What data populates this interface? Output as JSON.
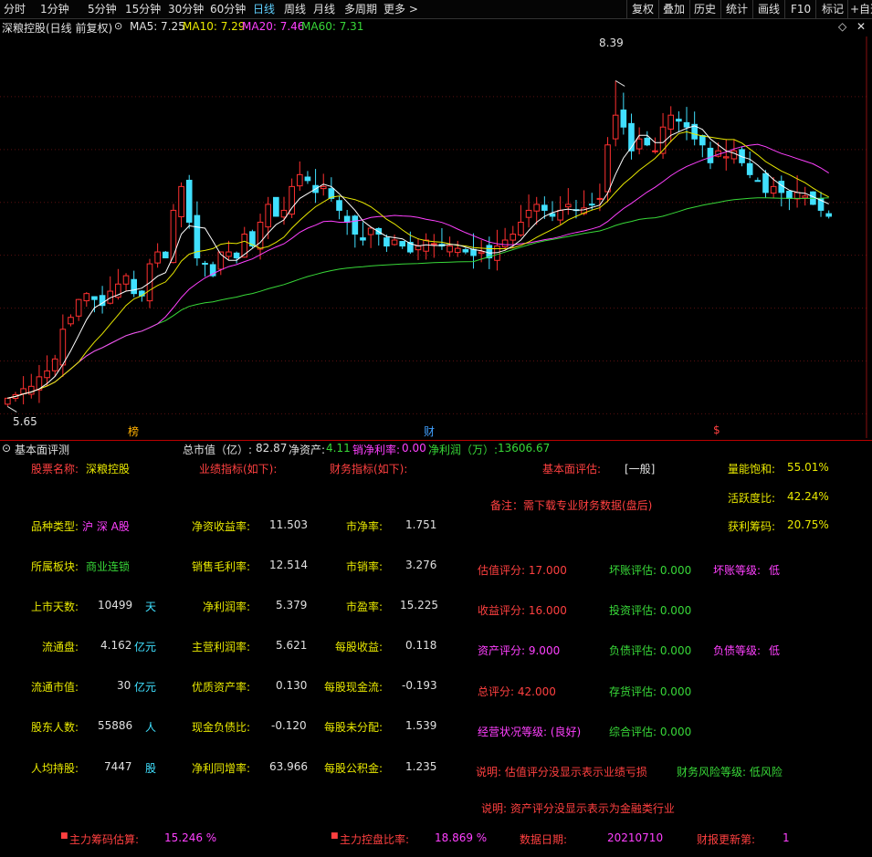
{
  "toolbar": {
    "periods": [
      "分时",
      "1分钟",
      "5分钟",
      "15分钟",
      "30分钟",
      "60分钟",
      "日线",
      "周线",
      "月线",
      "多周期",
      "更多 >"
    ],
    "active_period": "日线",
    "right_buttons": [
      "复权",
      "叠加",
      "历史",
      "统计",
      "画线",
      "F10",
      "标记",
      "+自选"
    ]
  },
  "indicator_bar": {
    "stock_title": "深粮控股(日线 前复权)",
    "ma5": "MA5: 7.25",
    "ma10": "MA10: 7.29",
    "ma20": "MA20: 7.46",
    "ma60": "MA60: 7.31"
  },
  "chart_data": {
    "type": "candlestick",
    "high_label": "8.39",
    "low_label": "5.65",
    "ylim": [
      5.5,
      8.7
    ],
    "markers": [
      "榜",
      "财",
      "$"
    ],
    "colors": {
      "up": "#ff3030",
      "down": "#40e0ff",
      "ma5": "#ffffff",
      "ma10": "#e8e800",
      "ma20": "#ff40ff",
      "ma60": "#38d838"
    },
    "closes": [
      5.72,
      5.75,
      5.8,
      5.82,
      5.9,
      5.95,
      6.05,
      6.3,
      6.4,
      6.55,
      6.6,
      6.55,
      6.5,
      6.62,
      6.68,
      6.75,
      6.6,
      6.58,
      6.85,
      6.95,
      6.9,
      7.3,
      7.5,
      7.2,
      6.9,
      6.85,
      6.75,
      6.95,
      6.95,
      6.9,
      7.1,
      7.0,
      7.2,
      7.35,
      7.25,
      7.3,
      7.5,
      7.6,
      7.55,
      7.45,
      7.5,
      7.4,
      7.3,
      7.2,
      7.1,
      7.05,
      7.15,
      7.1,
      7.0,
      7.05,
      7.0,
      6.95,
      7.0,
      7.05,
      7.02,
      7.0,
      7.0,
      6.98,
      6.95,
      6.92,
      6.95,
      6.9,
      7.0,
      7.05,
      7.1,
      7.2,
      7.3,
      7.35,
      7.3,
      7.25,
      7.3,
      7.35,
      7.3,
      7.32,
      7.35,
      7.4,
      7.85,
      8.1,
      8.0,
      7.8,
      7.9,
      7.85,
      7.8,
      8.0,
      8.1,
      8.05,
      8.0,
      7.9,
      7.85,
      7.7,
      7.8,
      7.75,
      7.8,
      7.7,
      7.6,
      7.55,
      7.45,
      7.5,
      7.45,
      7.4,
      7.45,
      7.42,
      7.35,
      7.3,
      7.25
    ]
  },
  "panel_header": {
    "title": "基本面评测",
    "summary_total_mv_label": "总市值（亿）:",
    "summary_total_mv": "82.87",
    "summary_net_asset_label": "净资产:",
    "summary_net_asset": "4.11",
    "summary_net_margin_label": "销净利率:",
    "summary_net_margin": "0.00",
    "summary_net_profit_label": "净利润（万）:",
    "summary_net_profit": "13606.67"
  },
  "fundamentals": {
    "stock_name_label": "股票名称:",
    "stock_name": "深粮控股",
    "perf_header": "业绩指标(如下):",
    "fin_header": "财务指标(如下):",
    "eval_label": "基本面评估:",
    "eval_value": "[一般]",
    "note": "备注：需下载专业财务数据(盘后)",
    "vol_sat_label": "量能饱和:",
    "vol_sat": "55.01%",
    "activity_label": "活跃度比:",
    "activity": "42.24%",
    "profit_chip_label": "获利筹码:",
    "profit_chip": "20.75%",
    "rows": [
      {
        "l1": "品种类型:",
        "v1": "沪 深 A股",
        "u1": "",
        "l2": "净资收益率:",
        "v2": "11.503",
        "l3": "市净率:",
        "v3": "1.751"
      },
      {
        "l1": "所属板块:",
        "v1": "商业连锁",
        "u1": "",
        "l2": "销售毛利率:",
        "v2": "12.514",
        "l3": "市销率:",
        "v3": "3.276"
      },
      {
        "l1": "上市天数:",
        "v1": "10499",
        "u1": "天",
        "l2": "净利润率:",
        "v2": "5.379",
        "l3": "市盈率:",
        "v3": "15.225"
      },
      {
        "l1": "流通盘:",
        "v1": "4.162",
        "u1": "亿元",
        "l2": "主营利润率:",
        "v2": "5.621",
        "l3": "每股收益:",
        "v3": "0.118"
      },
      {
        "l1": "流通市值:",
        "v1": "30",
        "u1": "亿元",
        "l2": "优质资产率:",
        "v2": "0.130",
        "l3": "每股现金流:",
        "v3": "-0.193"
      },
      {
        "l1": "股东人数:",
        "v1": "55886",
        "u1": "人",
        "l2": "现金负债比:",
        "v2": "-0.120",
        "l3": "每股未分配:",
        "v3": "1.539"
      },
      {
        "l1": "人均持股:",
        "v1": "7447",
        "u1": "股",
        "l2": "净利同增率:",
        "v2": "63.966",
        "l3": "每股公积金:",
        "v3": "1.235"
      }
    ],
    "score_valuation": "估值评分: 17.000",
    "score_income": "收益评分: 16.000",
    "score_asset": "资产评分: 9.000",
    "score_total": "总评分: 42.000",
    "bad_debt_eval": "坏账评估: 0.000",
    "bad_debt_level_label": "坏账等级:",
    "bad_debt_level": "低",
    "invest_eval": "投资评估: 0.000",
    "debt_eval": "负债评估: 0.000",
    "debt_level_label": "负债等级:",
    "debt_level": "低",
    "stock_eval": "存货评估: 0.000",
    "comp_eval": "综合评估: 0.000",
    "op_status": "经营状况等级: (良好)",
    "explain1": "说明: 估值评分没显示表示业绩亏损",
    "risk_level": "财务风险等级: 低风险",
    "explain2": "说明: 资产评分没显示表示为金融类行业"
  },
  "footer": {
    "main_chip_label": "主力筹码估算:",
    "main_chip": "15.246 %",
    "main_ctrl_label": "主力控盘比率:",
    "main_ctrl": "18.869 %",
    "data_date_label": "数据日期:",
    "data_date": "20210710",
    "report_update_label": "财报更新第:",
    "report_update": "1"
  }
}
